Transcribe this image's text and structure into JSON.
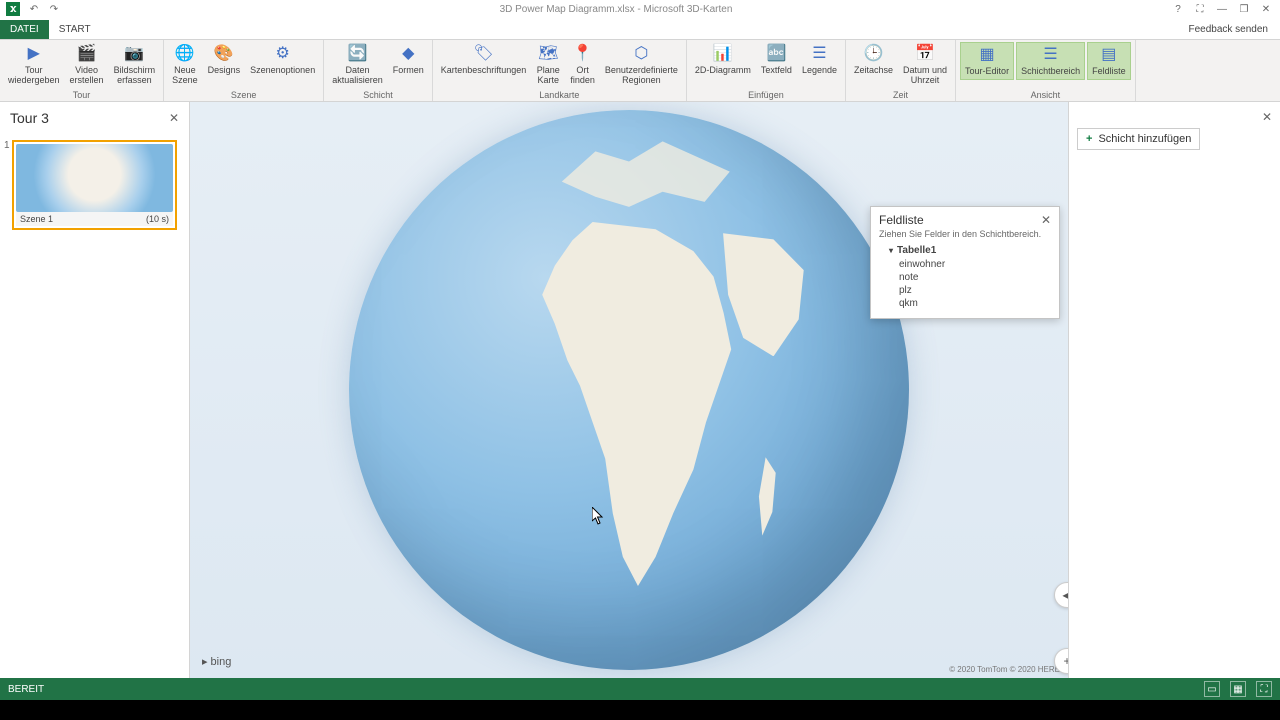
{
  "titlebar": {
    "app_name": "3D Power Map Diagramm.xlsx - Microsoft 3D-Karten",
    "help": "?",
    "fullscreen": "⛶",
    "minimize": "—",
    "restore": "❐",
    "close": "✕"
  },
  "tabs": {
    "file": "DATEI",
    "start": "START",
    "feedback": "Feedback senden"
  },
  "ribbon": {
    "groups": {
      "tour": "Tour",
      "szene": "Szene",
      "schicht": "Schicht",
      "landkarte": "Landkarte",
      "einfuegen": "Einfügen",
      "zeit": "Zeit",
      "ansicht": "Ansicht"
    },
    "buttons": {
      "tour_wiedergeben": "Tour\nwiedergeben",
      "video_erstellen": "Video\nerstellen",
      "bildschirm_erfassen": "Bildschirm\nerfassen",
      "neue_szene": "Neue\nSzene",
      "designs": "Designs",
      "szenenoptionen": "Szenenoptionen",
      "daten_aktualisieren": "Daten\naktualisieren",
      "formen": "Formen",
      "kartenbeschriftungen": "Kartenbeschriftungen",
      "plane_karte": "Plane\nKarte",
      "ort_finden": "Ort\nfinden",
      "benutzerdefinierte_regionen": "Benutzerdefinierte\nRegionen",
      "2d_diagramm": "2D-Diagramm",
      "textfeld": "Textfeld",
      "legende": "Legende",
      "zeitachse": "Zeitachse",
      "datum_uhrzeit": "Datum und\nUhrzeit",
      "tour_editor": "Tour-Editor",
      "schichtbereich": "Schichtbereich",
      "feldliste": "Feldliste"
    }
  },
  "tour_panel": {
    "title": "Tour 3",
    "scene": {
      "num": "1",
      "name": "Szene 1",
      "duration": "(10 s)"
    }
  },
  "field_list": {
    "title": "Feldliste",
    "hint": "Ziehen Sie Felder in den Schichtbereich.",
    "table_name": "Tabelle1",
    "fields": [
      "einwohner",
      "note",
      "plz",
      "qkm"
    ]
  },
  "layer_panel": {
    "add_label": "Schicht hinzufügen"
  },
  "map": {
    "bing": "bing",
    "copyright": "© 2020 TomTom © 2020 HERE"
  },
  "status": {
    "ready": "BEREIT"
  }
}
